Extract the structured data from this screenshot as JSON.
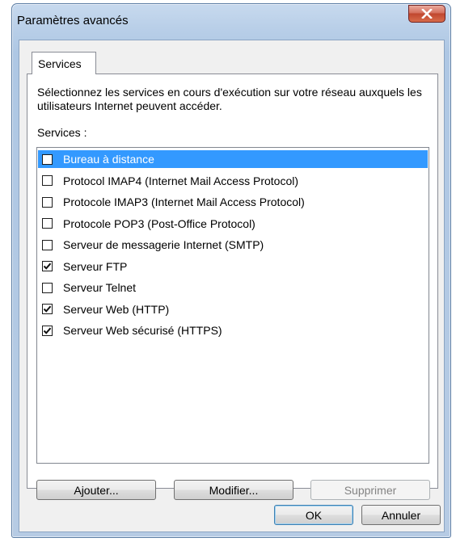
{
  "window": {
    "title": "Paramètres avancés",
    "close_glyph": "x"
  },
  "tabs": [
    {
      "label": "Services",
      "active": true
    }
  ],
  "description": "Sélectionnez les services en cours d'exécution sur votre réseau auxquels les utilisateurs Internet peuvent accéder.",
  "services_label": "Services :",
  "services": [
    {
      "label": "Bureau à distance",
      "checked": false,
      "selected": true
    },
    {
      "label": "Protocol IMAP4 (Internet Mail Access Protocol)",
      "checked": false,
      "selected": false
    },
    {
      "label": "Protocole IMAP3 (Internet Mail Access Protocol)",
      "checked": false,
      "selected": false
    },
    {
      "label": "Protocole POP3 (Post-Office Protocol)",
      "checked": false,
      "selected": false
    },
    {
      "label": "Serveur de messagerie Internet (SMTP)",
      "checked": false,
      "selected": false
    },
    {
      "label": "Serveur FTP",
      "checked": true,
      "selected": false
    },
    {
      "label": "Serveur Telnet",
      "checked": false,
      "selected": false
    },
    {
      "label": "Serveur Web (HTTP)",
      "checked": true,
      "selected": false
    },
    {
      "label": "Serveur Web sécurisé (HTTPS)",
      "checked": true,
      "selected": false
    }
  ],
  "buttons": {
    "add": "Ajouter...",
    "modify": "Modifier...",
    "delete": "Supprimer",
    "ok": "OK",
    "cancel": "Annuler"
  },
  "colors": {
    "selection": "#3399ff",
    "close_button": "#c7462f"
  }
}
